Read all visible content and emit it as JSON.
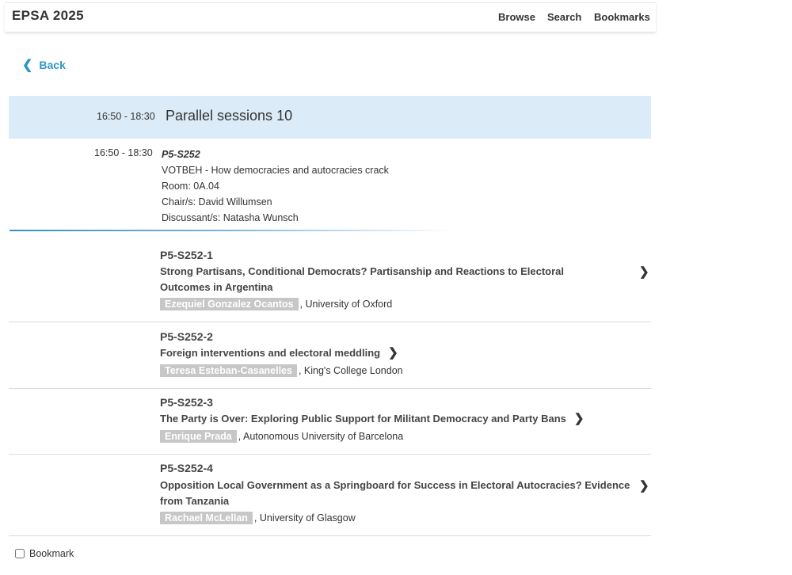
{
  "header": {
    "brand": "EPSA 2025",
    "nav": {
      "browse": "Browse",
      "search": "Search",
      "bookmarks": "Bookmarks"
    }
  },
  "back": {
    "chevron": "❮",
    "label": "Back"
  },
  "session_header": {
    "time": "16:50 - 18:30",
    "title": "Parallel sessions 10"
  },
  "session": {
    "time": "16:50 - 18:30",
    "code": "P5-S252",
    "title": "VOTBEH - How democracies and autocracies crack",
    "room": "Room: 0A.04",
    "chairs": "Chair/s: David Willumsen",
    "discussants": "Discussant/s: Natasha Wunsch"
  },
  "papers": [
    {
      "code": "P5-S252-1",
      "title": "Strong Partisans, Conditional Democrats? Partisanship and Reactions to Electoral Outcomes in Argentina",
      "author": "Ezequiel Gonzalez Ocantos",
      "affiliation": ", University of Oxford",
      "arrow": "❯"
    },
    {
      "code": "P5-S252-2",
      "title": "Foreign interventions and electoral meddling",
      "author": "Teresa Esteban-Casanelles",
      "affiliation": ", King's College London",
      "arrow": "❯"
    },
    {
      "code": "P5-S252-3",
      "title": "The Party is Over: Exploring Public Support for Militant Democracy and Party Bans",
      "author": "Enrique Prada",
      "affiliation": ", Autonomous University of Barcelona",
      "arrow": "❯"
    },
    {
      "code": "P5-S252-4",
      "title": "Opposition Local Government as a Springboard for Success in Electoral Autocracies? Evidence from Tanzania",
      "author": "Rachael McLellan",
      "affiliation": ", University of Glasgow",
      "arrow": "❯"
    }
  ],
  "bookmark": {
    "label": "Bookmark",
    "checked": false
  }
}
